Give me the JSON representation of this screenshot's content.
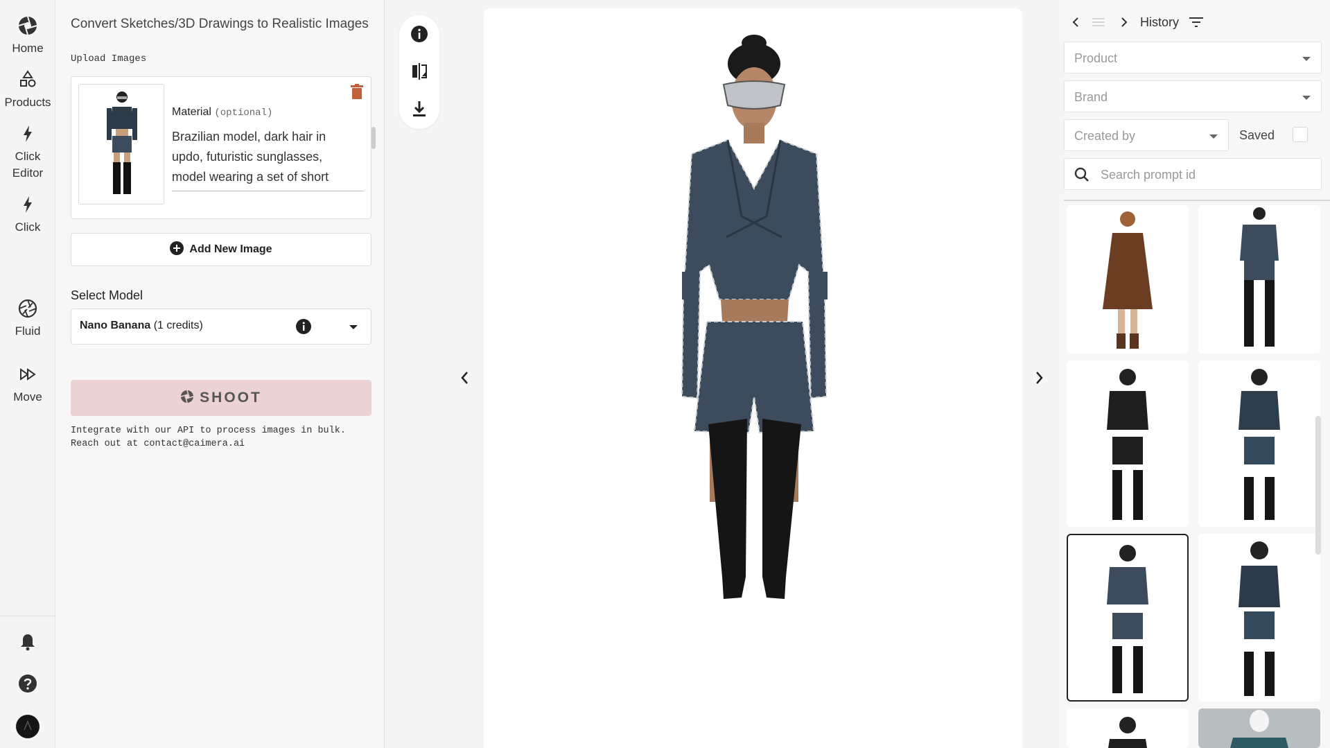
{
  "nav": {
    "items": [
      {
        "label": "Home",
        "icon": "aperture-icon"
      },
      {
        "label": "Products",
        "icon": "shapes-icon"
      },
      {
        "label": "Click Editor",
        "icon": "bolt-icon"
      },
      {
        "label": "Click",
        "icon": "bolt-icon"
      },
      {
        "label": "Fluid",
        "icon": "aperture-outline-icon"
      },
      {
        "label": "Move",
        "icon": "fast-forward-icon"
      }
    ],
    "bottom": [
      "bell-icon",
      "help-icon",
      "avatar"
    ]
  },
  "panel": {
    "title": "Convert Sketches/3D Drawings to Realistic Images",
    "upload_label": "Upload Images",
    "material_label": "Material",
    "material_optional": "(optional)",
    "material_text": "Brazilian model, dark hair in updo, futuristic sunglasses, model wearing a set of short",
    "add_image": "Add New Image",
    "select_model_label": "Select Model",
    "model_name": "Nano Banana",
    "model_credits": "(1 credits)",
    "shoot": "SHOOT",
    "api_note": "Integrate with our API to process images in bulk.\nReach out at contact@caimera.ai"
  },
  "toolbar": [
    "info-icon",
    "compare-icon",
    "download-icon"
  ],
  "history": {
    "title": "History",
    "product_placeholder": "Product",
    "brand_placeholder": "Brand",
    "created_by_placeholder": "Created by",
    "saved_label": "Saved",
    "search_placeholder": "Search prompt id",
    "selected_index": 4
  },
  "colors": {
    "accent": "#ecd3d3",
    "trash": "#c0603a",
    "denim": "#3d4c5c",
    "leather": "#151515"
  }
}
